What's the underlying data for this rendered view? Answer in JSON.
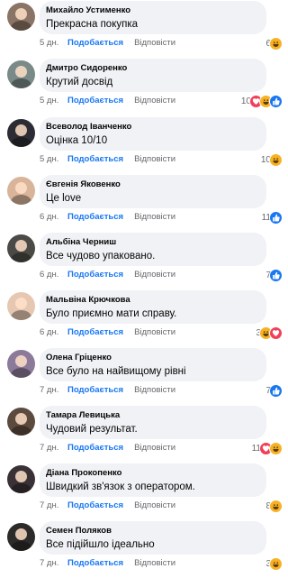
{
  "actions": {
    "like": "Подобається",
    "reply": "Відповісти"
  },
  "reaction_colors": {
    "like": "#1877f2",
    "love": "#f33e58",
    "haha": "#f7b125"
  },
  "comments": [
    {
      "author": "Михайло Устименко",
      "text": "Прекрасна покупка",
      "time": "5 дн.",
      "reaction_count": "6",
      "reactions": [
        "haha"
      ],
      "avatar": "#8a7465"
    },
    {
      "author": "Дмитро Сидоренко",
      "text": "Крутий досвід",
      "time": "5 дн.",
      "reaction_count": "10",
      "reactions": [
        "love",
        "haha",
        "like"
      ],
      "avatar": "#7a8a88"
    },
    {
      "author": "Всеволод Іванченко",
      "text": "Оцінка 10/10",
      "time": "5 дн.",
      "reaction_count": "10",
      "reactions": [
        "haha"
      ],
      "avatar": "#2c2c34"
    },
    {
      "author": "Євгенія Яковенко",
      "text": "Це love",
      "time": "6 дн.",
      "reaction_count": "11",
      "reactions": [
        "like"
      ],
      "avatar": "#d8b49a"
    },
    {
      "author": "Альбіна Черниш",
      "text": "Все чудово упаковано.",
      "time": "6 дн.",
      "reaction_count": "7",
      "reactions": [
        "like"
      ],
      "avatar": "#4b4a46"
    },
    {
      "author": "Мальвіна Крючкова",
      "text": "Було приємно мати справу.",
      "time": "6 дн.",
      "reaction_count": "3",
      "reactions": [
        "haha",
        "love"
      ],
      "avatar": "#e6c8b2"
    },
    {
      "author": "Олена Гріценко",
      "text": "Все було на найвищому рівні",
      "time": "7 дн.",
      "reaction_count": "7",
      "reactions": [
        "like"
      ],
      "avatar": "#8c7a9a"
    },
    {
      "author": "Тамара Левицька",
      "text": "Чудовий результат.",
      "time": "7 дн.",
      "reaction_count": "11",
      "reactions": [
        "love",
        "haha"
      ],
      "avatar": "#5d4a3e"
    },
    {
      "author": "Діана Прокопенко",
      "text": "Швидкий зв'язок з оператором.",
      "time": "7 дн.",
      "reaction_count": "8",
      "reactions": [
        "haha"
      ],
      "avatar": "#3a3136"
    },
    {
      "author": "Семен Поляков",
      "text": "Все підійшло ідеально",
      "time": "7 дн.",
      "reaction_count": "3",
      "reactions": [
        "haha"
      ],
      "avatar": "#2d2b2a"
    }
  ]
}
